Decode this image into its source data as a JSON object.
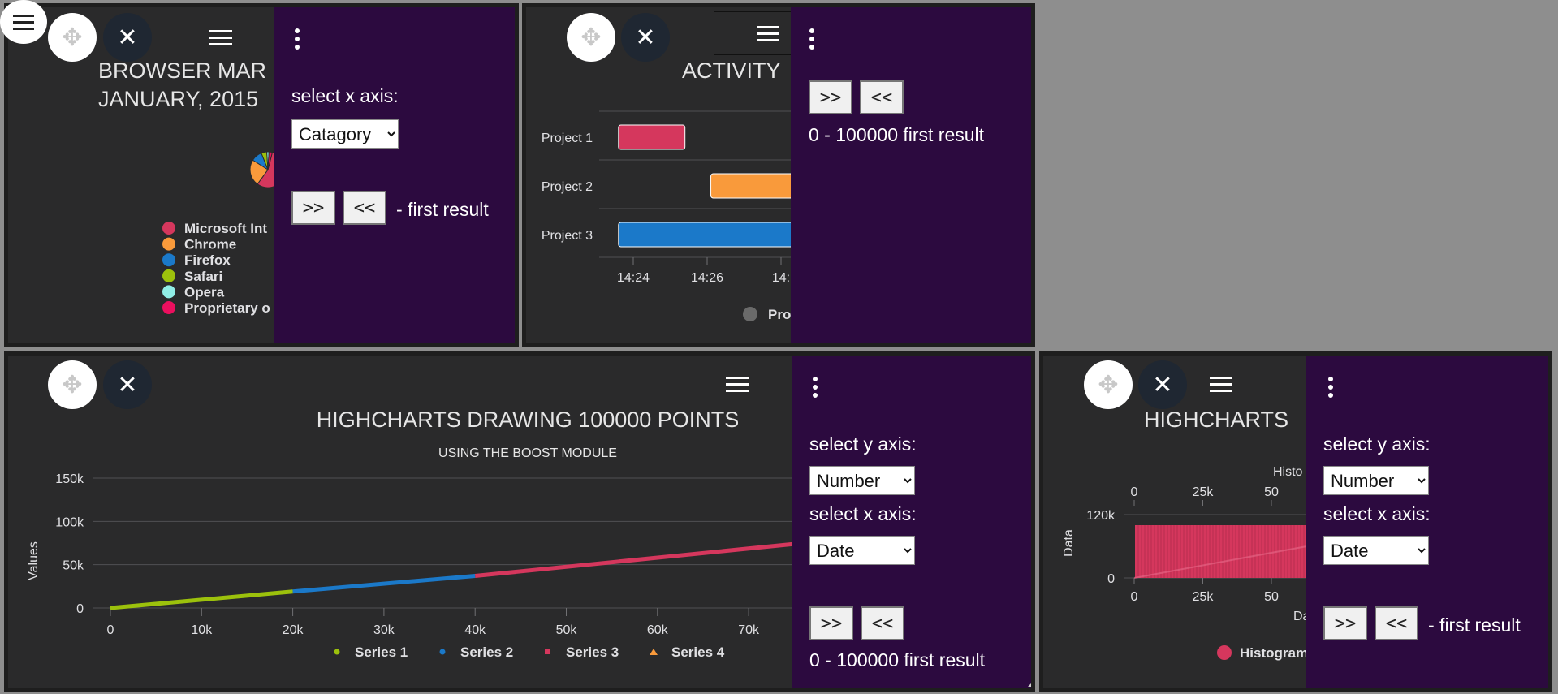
{
  "global": {
    "menu_icon": "hamburger-icon"
  },
  "panels": {
    "browser": {
      "title_line1": "BROWSER MAR",
      "title_line2": "JANUARY, 2015",
      "legend": [
        {
          "label": "Microsoft Int",
          "color": "#d5375d"
        },
        {
          "label": "Chrome",
          "color": "#f99a3b"
        },
        {
          "label": "Firefox",
          "color": "#1b79c9"
        },
        {
          "label": "Safari",
          "color": "#9cc10c"
        },
        {
          "label": "Opera",
          "color": "#90eee6"
        },
        {
          "label": "Proprietary o",
          "color": "#eb0f5e"
        }
      ],
      "side": {
        "select_x_label": "select x axis:",
        "select_x_value": "Catagory",
        "next": ">>",
        "prev": "<<",
        "result": "- first result"
      }
    },
    "activity": {
      "title": "ACTIVITY",
      "side": {
        "next": ">>",
        "prev": "<<",
        "result": "0 - 100000 first result"
      },
      "legend_label": "Pro"
    },
    "boost": {
      "title": "HIGHCHARTS DRAWING 100000 POINTS",
      "subtitle": "USING THE BOOST MODULE",
      "ylabel": "Values",
      "side": {
        "select_y_label": "select y axis:",
        "select_y_value": "Number",
        "select_x_label": "select x axis:",
        "select_x_value": "Date",
        "next": ">>",
        "prev": "<<",
        "result": "0 - 100000 first result"
      }
    },
    "hist": {
      "title": "HIGHCHARTS",
      "top_axis_title": "Histo",
      "ylabel": "Data",
      "xlabel": "Da",
      "legend_label": "Histogram",
      "side": {
        "select_y_label": "select y axis:",
        "select_y_value": "Number",
        "select_x_label": "select x axis:",
        "select_x_value": "Date",
        "next": ">>",
        "prev": "<<",
        "result": "- first result"
      }
    }
  },
  "chart_data": [
    {
      "type": "pie",
      "title": "BROWSER MAR JANUARY, 2015",
      "categories": [
        "Microsoft Int",
        "Chrome",
        "Firefox",
        "Safari",
        "Opera",
        "Proprietary o"
      ],
      "colors": [
        "#d5375d",
        "#f99a3b",
        "#1b79c9",
        "#9cc10c",
        "#90eee6",
        "#eb0f5e"
      ],
      "values": [
        56,
        24,
        10,
        5,
        2,
        3
      ]
    },
    {
      "type": "bar",
      "title": "ACTIVITY",
      "categories": [
        "Project 1",
        "Project 2",
        "Project 3"
      ],
      "x_ticks": [
        "14:24",
        "14:26",
        "14:"
      ],
      "series": [
        {
          "values": [
            [
              "14:23.6",
              "14:25.4"
            ],
            [
              "14:26.1",
              "14:28.4"
            ],
            [
              "14:23.6",
              "14:28.4"
            ]
          ],
          "colors": [
            "#d5375d",
            "#f99a3b",
            "#1b79c9"
          ]
        }
      ]
    },
    {
      "type": "line",
      "title": "HIGHCHARTS DRAWING 100000 POINTS",
      "subtitle": "USING THE BOOST MODULE",
      "ylabel": "Values",
      "ylim": [
        0,
        150000
      ],
      "y_ticks": [
        "0",
        "50k",
        "100k",
        "150k"
      ],
      "x_ticks": [
        "0",
        "10k",
        "20k",
        "30k",
        "40k",
        "50k",
        "60k",
        "70k"
      ],
      "series": [
        {
          "name": "Series 1",
          "color": "#9cc10c",
          "x": [
            0,
            20000
          ],
          "y": [
            0,
            19000
          ]
        },
        {
          "name": "Series 2",
          "color": "#1b79c9",
          "x": [
            20000,
            40000
          ],
          "y": [
            19000,
            37000
          ]
        },
        {
          "name": "Series 3",
          "color": "#d5375d",
          "x": [
            40000,
            76000
          ],
          "y": [
            37000,
            75000
          ]
        },
        {
          "name": "Series 4",
          "color": "#f99a3b",
          "x": [],
          "y": []
        }
      ]
    },
    {
      "type": "bar",
      "title": "HIGHCHARTS",
      "ylabel": "Data",
      "ylim": [
        0,
        120000
      ],
      "y_ticks": [
        "0",
        "120k"
      ],
      "x_ticks": [
        "0",
        "25k",
        "50"
      ],
      "series": [
        {
          "name": "Histogram",
          "color": "#d5375d",
          "value": 100000
        }
      ]
    }
  ]
}
